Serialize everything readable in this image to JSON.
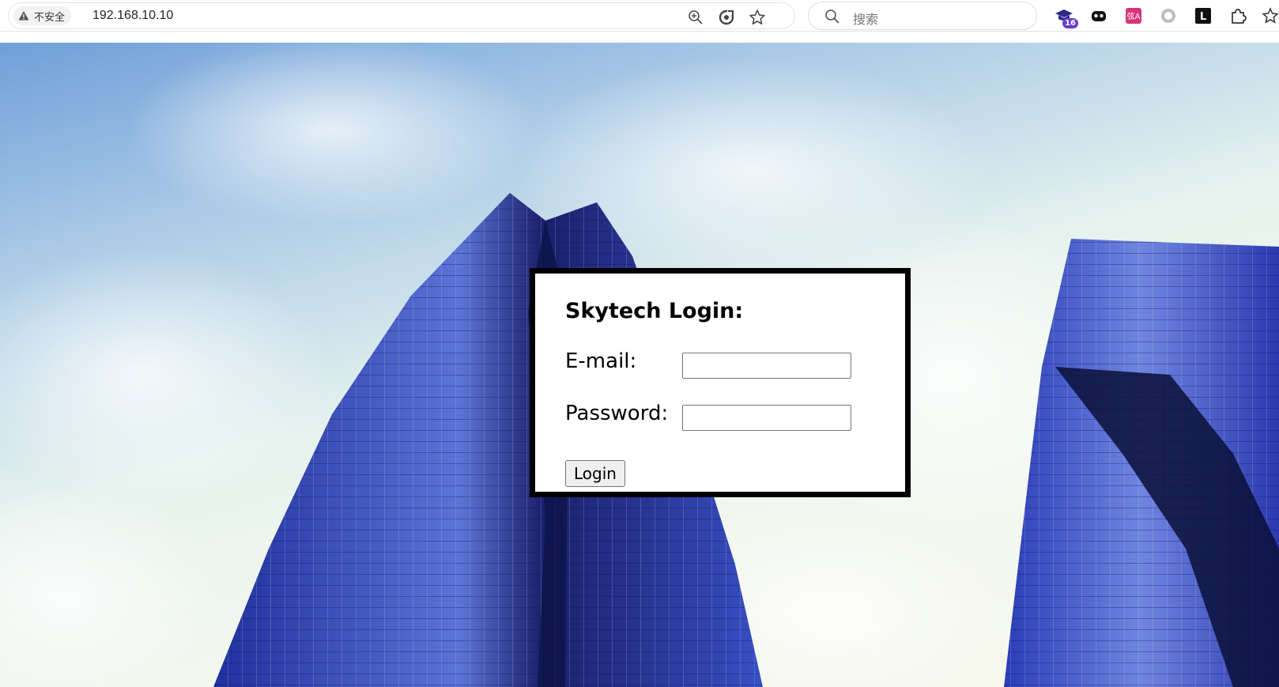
{
  "browser": {
    "security_label": "不安全",
    "url": "192.168.10.10",
    "search_placeholder": "搜索",
    "extensions": [
      {
        "icon": "graduation-cap-icon",
        "badge": "16"
      },
      {
        "icon": "game-controller-icon"
      },
      {
        "icon": "translate-icon",
        "text": "弦A"
      },
      {
        "icon": "circle-icon"
      },
      {
        "icon": "l-letter-icon",
        "text": "L"
      },
      {
        "icon": "puzzle-icon"
      }
    ]
  },
  "login": {
    "title": "Skytech Login:",
    "email_label": "E-mail:",
    "email_value": "",
    "password_label": "Password:",
    "password_value": "",
    "button_label": "Login"
  },
  "colors": {
    "sky_top": "#6f9fd8",
    "sky_light": "#e6f2ee",
    "building_blue": "#2c3fb0",
    "building_dark": "#0d1240",
    "box_border": "#000000"
  }
}
